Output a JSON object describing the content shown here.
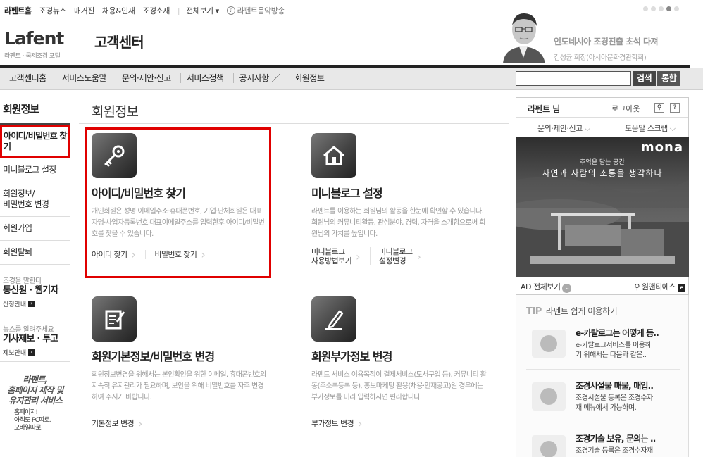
{
  "util": {
    "links": [
      "라펜트홈",
      "조경뉴스",
      "매거진",
      "채용&인재",
      "조경소재"
    ],
    "all_view": "전체보기 ▾",
    "radio": "라펜트음악방송"
  },
  "brand": {
    "logo": "Lafent",
    "tagline": "라펜트 · 국제조경 포털",
    "section": "고객센터"
  },
  "news": {
    "headline": "인도네시아 조경진출 초석 다져",
    "byline": "김성균 회장(아시아문화경관학회)"
  },
  "gnb": {
    "menu": [
      "고객센터홈",
      "서비스도움말",
      "문의·제안·신고",
      "서비스정책",
      "공지사항",
      "회원정보"
    ],
    "search_button": "검색",
    "integrated_button": "통합"
  },
  "lnb": {
    "title": "회원정보",
    "items": [
      "아이디/비밀번호 찾기",
      "미니블로그 설정",
      "회원정보/\n비밀번호 변경",
      "회원가입",
      "회원탈퇴"
    ],
    "promo1": {
      "small": "조경을 말한다",
      "big": "통신원 · 웹기자",
      "more": "신청안내"
    },
    "promo2": {
      "small": "뉴스를 알려주세요",
      "big": "기사제보 · 투고",
      "more": "제보안내"
    },
    "promo3": {
      "title": "라펜트,\n홈페이지 제작 및\n유지관리 서비스",
      "sub": "홈페이지!\n아직도 PC따로,\n모바일따로"
    }
  },
  "main": {
    "title": "회원정보",
    "cards": [
      {
        "title": "아이디/비밀번호 찾기",
        "desc": "개인회원은 성명·이메일주소·휴대폰번호, 기업·단체회원은 대표자명·사업자등록번호·대표이메일주소를 입력한후 아이디/비밀번호를 찾을 수 있습니다.",
        "links": [
          "아이디 찾기",
          "비밀번호 찾기"
        ]
      },
      {
        "title": "미니블로그 설정",
        "desc": "라펜트를 이용하는 회원님의 활동을 한눈에 확인할 수 있습니다. 회원님의 커뮤니티활동, 관심분야, 경력, 자격을 소개함으로써 회원님의 가치를 높입니다.",
        "links": [
          "미니블로그\n사용방법보기",
          "미니블로그\n설정변경"
        ]
      },
      {
        "title": "회원기본정보/비밀번호 변경",
        "desc": "회원정보변경을 위해서는 본인확인을 위한 이메일, 휴대폰번호의 지속적 유지관리가 필요하며, 보안을 위해 비밀번호를 자주 변경하여 주시기 바랍니다.",
        "links": [
          "기본정보 변경"
        ]
      },
      {
        "title": "회원부가정보 변경",
        "desc": "라펜트 서비스 이용목적이 결제서비스(도서구입 등), 커뮤니티 활동(주소록등록 등), 홍보마케팅 활용(채용·인재공고)일 경우에는 부가정보를 미리 입력하시면 편리합니다.",
        "links": [
          "부가정보 변경"
        ]
      }
    ]
  },
  "side": {
    "user": "라펜트 님",
    "logout": "로그아웃",
    "menu1": "문의·제안·신고",
    "menu2": "도움말 스크랩",
    "ad_brand": "mona",
    "ad_copy1": "추억을 담는 공간",
    "ad_copy2": "자연과 사람의 소통을 생각하다",
    "ad_all": "AD 전체보기",
    "ad_company": "원앤티에스",
    "tip_label": "TIP",
    "tip_title": "라펜트 쉽게 이용하기",
    "tips": [
      {
        "t": "e-카탈로그는 어떻게 등..",
        "d": "e-카탈로그서비스를 이용하\n기 위해서는 다음과 같은.."
      },
      {
        "t": "조경시설물 매물, 매입..",
        "d": "조경시설물 등록은 조경수자\n재 메뉴에서 가능하며."
      },
      {
        "t": "조경기술 보유, 문의는 ..",
        "d": "조경기술 등록은 조경수자재"
      }
    ]
  }
}
